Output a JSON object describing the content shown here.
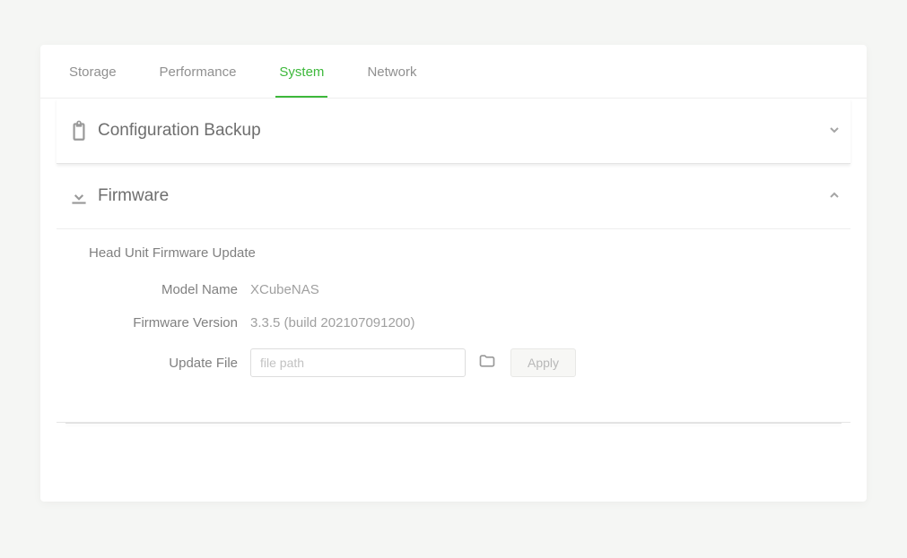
{
  "tabs": {
    "storage": "Storage",
    "performance": "Performance",
    "system": "System",
    "network": "Network"
  },
  "sections": {
    "config_backup": {
      "title": "Configuration Backup"
    },
    "firmware": {
      "title": "Firmware",
      "subheading": "Head Unit Firmware Update",
      "model_name_label": "Model Name",
      "model_name_value": "XCubeNAS",
      "fw_version_label": "Firmware Version",
      "fw_version_value": "3.3.5 (build 202107091200)",
      "update_file_label": "Update File",
      "update_file_placeholder": "file path",
      "apply_label": "Apply"
    }
  }
}
